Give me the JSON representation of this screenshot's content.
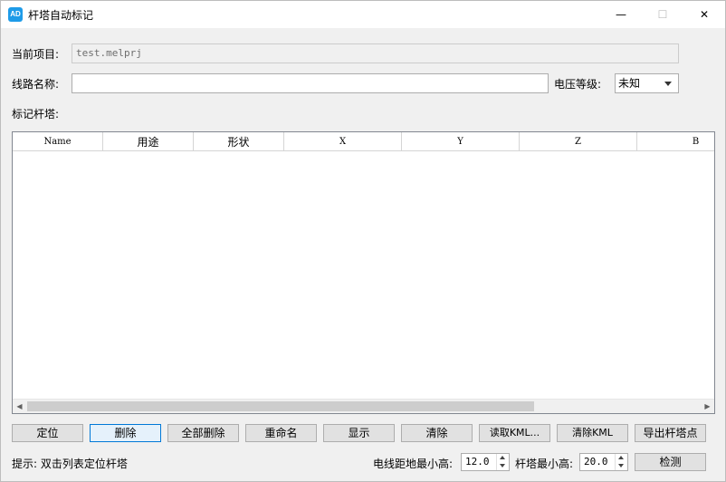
{
  "window": {
    "title": "杆塔自动标记",
    "icon_text": "AD",
    "minimize_glyph": "—",
    "maximize_glyph": "☐",
    "close_glyph": "✕"
  },
  "form": {
    "project_label": "当前项目:",
    "project_value": "test.melprj",
    "line_name_label": "线路名称:",
    "line_name_value": "",
    "voltage_label": "电压等级:",
    "voltage_value": "未知",
    "marked_towers_label": "标记杆塔:"
  },
  "table": {
    "columns": [
      "Name",
      "用途",
      "形状",
      "X",
      "Y",
      "Z",
      "B"
    ],
    "rows": []
  },
  "buttons": {
    "locate": "定位",
    "delete": "删除",
    "delete_all": "全部删除",
    "rename": "重命名",
    "show": "显示",
    "clear": "清除",
    "read_kml": "读取KML...",
    "clear_kml": "清除KML",
    "export_points": "导出杆塔点",
    "detect": "检测"
  },
  "footer": {
    "hint": "提示: 双击列表定位杆塔",
    "wire_min_height_label": "电线距地最小高:",
    "wire_min_height_value": "12.0",
    "tower_min_height_label": "杆塔最小高:",
    "tower_min_height_value": "20.0"
  },
  "colors": {
    "accent": "#0078d7",
    "app_icon": "#1e9be8"
  }
}
